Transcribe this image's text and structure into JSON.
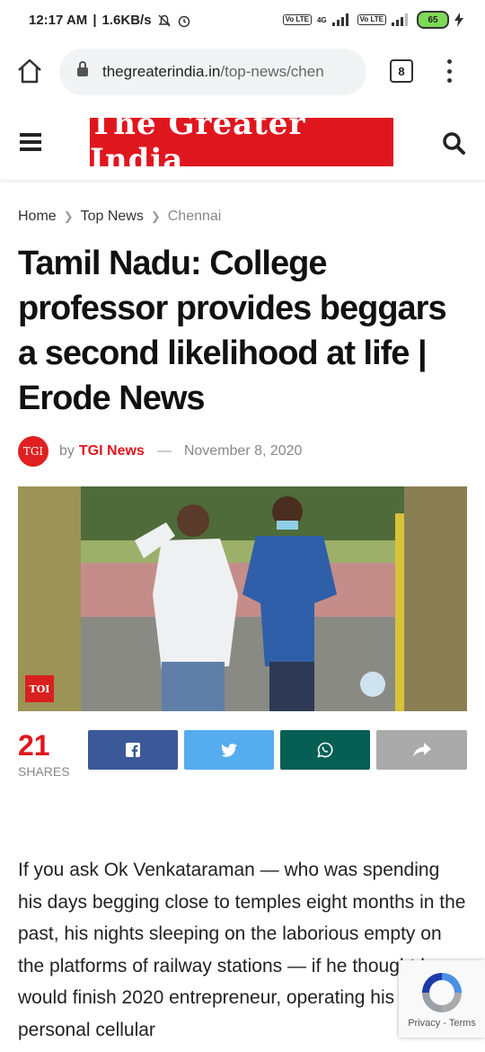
{
  "status_bar": {
    "time": "12:17 AM",
    "speed": "1.6KB/s",
    "net1": "Vo LTE",
    "net_type": "4G",
    "net2": "Vo LTE",
    "battery": "65"
  },
  "browser": {
    "url_domain": "thegreaterindia.in",
    "url_path": "/top-news/chen",
    "tab_count": "8"
  },
  "site": {
    "logo_text": "The Greater India"
  },
  "breadcrumb": [
    "Home",
    "Top News",
    "Chennai"
  ],
  "article": {
    "title": "Tamil Nadu: College professor provides beggars a second likelihood at life | Erode News",
    "author_avatar_text": "TGI",
    "by": "by",
    "author": "TGI News",
    "dash": "—",
    "date": "November 8, 2020",
    "photo_badge": "TOI",
    "body": "If you ask Ok Venkataraman — who was spending his days begging close to temples eight months in the past, his nights sleeping on the laborious empty on the platforms of railway stations — if he thought he would finish 2020 entrepreneur, operating his personal cellular"
  },
  "share": {
    "count": "21",
    "label": "SHARES",
    "buttons": [
      {
        "name": "facebook",
        "icon": "facebook-icon",
        "color": "#3b5998"
      },
      {
        "name": "twitter",
        "icon": "twitter-icon",
        "color": "#55acee"
      },
      {
        "name": "whatsapp",
        "icon": "whatsapp-icon",
        "color": "#075e54"
      },
      {
        "name": "share",
        "icon": "share-icon",
        "color": "#aaaaaa"
      }
    ]
  },
  "recaptcha": {
    "privacy": "Privacy",
    "sep": " - ",
    "terms": "Terms"
  },
  "colors": {
    "brand_red": "#e0161f"
  }
}
